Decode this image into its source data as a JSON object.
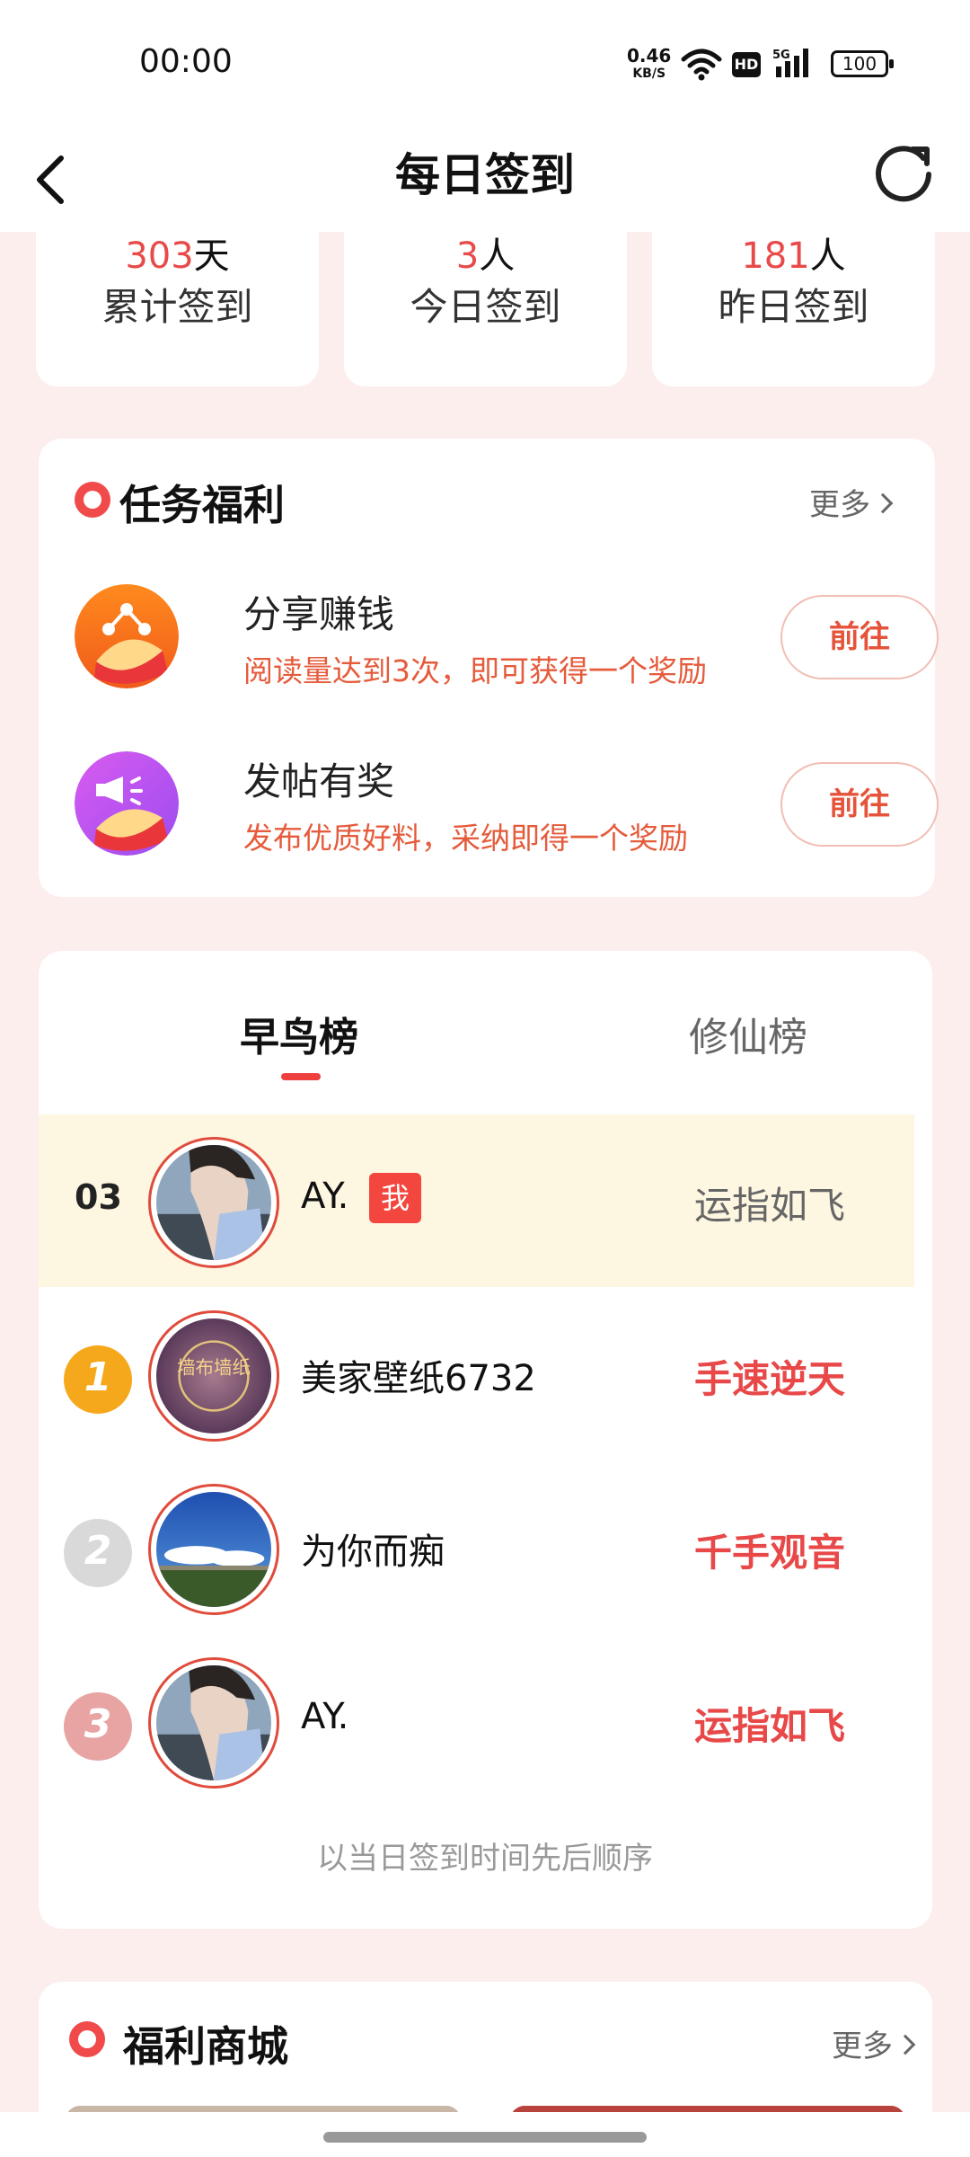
{
  "status_bar": {
    "time": "00:00",
    "net_speed": "0.46",
    "net_unit": "KB/S",
    "hd": "HD",
    "signal": "5G",
    "battery": "100"
  },
  "nav": {
    "title": "每日签到"
  },
  "stats": [
    {
      "value": "303",
      "unit": "天",
      "label": "累计签到"
    },
    {
      "value": "3",
      "unit": "人",
      "label": "今日签到"
    },
    {
      "value": "181",
      "unit": "人",
      "label": "昨日签到"
    }
  ],
  "tasks": {
    "title": "任务福利",
    "more": "更多",
    "items": [
      {
        "title": "分享赚钱",
        "desc": "阅读量达到3次，即可获得一个奖励",
        "button": "前往"
      },
      {
        "title": "发帖有奖",
        "desc": "发布优质好料，采纳即得一个奖励",
        "button": "前往"
      }
    ]
  },
  "ranking": {
    "tabs": [
      "早鸟榜",
      "修仙榜"
    ],
    "me": {
      "rank": "03",
      "name": "AY.",
      "badge": "我",
      "tag": "运指如飞"
    },
    "rows": [
      {
        "rank": "1",
        "name": "美家壁纸6732",
        "tag": "手速逆天"
      },
      {
        "rank": "2",
        "name": "为你而痴",
        "tag": "千手观音"
      },
      {
        "rank": "3",
        "name": "AY.",
        "tag": "运指如飞"
      }
    ],
    "footnote": "以当日签到时间先后顺序",
    "avatar_text": "墙布墙纸"
  },
  "mall": {
    "title": "福利商城",
    "more": "更多"
  },
  "colors": {
    "accent": "#e84a4a",
    "background": "#fdeeee",
    "me_row": "#fdf6e1"
  }
}
